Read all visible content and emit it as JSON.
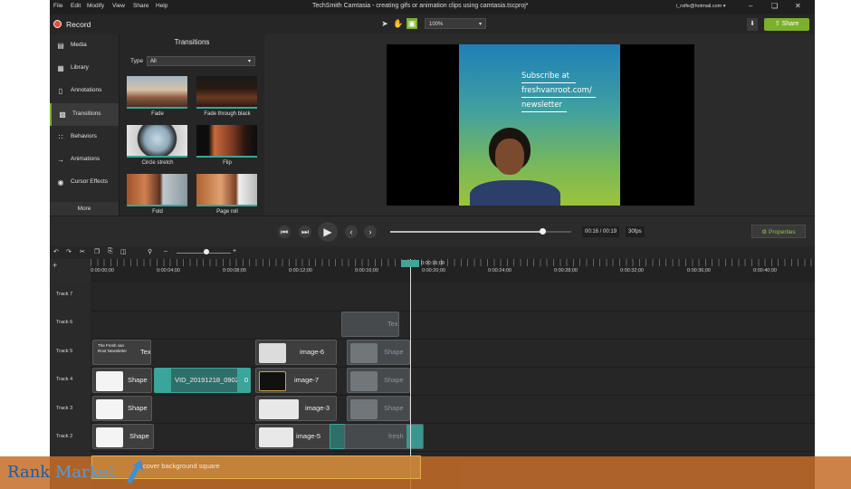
{
  "menubar": {
    "items": [
      "File",
      "Edit",
      "Modify",
      "View",
      "Share",
      "Help"
    ],
    "title": "TechSmith Camtasia - creating gifs or animation clips using camtasia.tscproj*",
    "user": "i_rolfe@hotmail.com ▾"
  },
  "toolbar": {
    "record_label": "Record",
    "zoom": "100%",
    "share_label": "Share"
  },
  "sidebar": {
    "items": [
      {
        "label": "Media"
      },
      {
        "label": "Library"
      },
      {
        "label": "Annotations"
      },
      {
        "label": "Transitions"
      },
      {
        "label": "Behaviors"
      },
      {
        "label": "Animations"
      },
      {
        "label": "Cursor Effects"
      }
    ],
    "more_label": "More"
  },
  "transitions": {
    "title": "Transitions",
    "type_label": "Type",
    "type_value": "All",
    "items": [
      {
        "label": "Fade"
      },
      {
        "label": "Fade through black"
      },
      {
        "label": "Circle stretch"
      },
      {
        "label": "Flip"
      },
      {
        "label": "Fold"
      },
      {
        "label": "Page roll"
      }
    ]
  },
  "preview": {
    "lines": [
      "Subscribe at",
      "freshvanroot.com/",
      "newsletter"
    ]
  },
  "playback": {
    "time": "00:16 / 00:19",
    "fps": "30fps",
    "progress": 0.84,
    "properties_label": "Properties"
  },
  "timeline": {
    "playhead_time": "0:00:16;08",
    "ticks": [
      "0:00:00;00",
      "0:00:04;00",
      "0:00:08;00",
      "0:00:12;00",
      "0:00:16;00",
      "0:00:20;00",
      "0:00:24;00",
      "0:00:28;00",
      "0:00:32;00",
      "0:00:36;00",
      "0:00:40;00"
    ],
    "tracks": [
      "Track 7",
      "Track 6",
      "Track 5",
      "Track 4",
      "Track 3",
      "Track 2"
    ],
    "clips": {
      "t6_ghost": "Tex",
      "t5_text": "Tex",
      "t5_newsletter": "The Fresh van Root Newsletter",
      "t5_image": "image-6",
      "t5_ghost": "Shape",
      "t4_shape": "Shape",
      "t4_vid": "VID_20191218_0902",
      "t4_vid_tail": "0",
      "t4_image": "image-7",
      "t4_ghost": "Shape",
      "t3_shape": "Shape",
      "t3_image": "image-3",
      "t3_ghost": "Shape",
      "t2_shape": "Shape",
      "t2_image": "image-5",
      "t2_ghost": "fresh"
    }
  },
  "overlay": {
    "clip_label": "cover background square",
    "brand_rank": "Rank",
    "brand_market": "Market"
  },
  "colors": {
    "accent": "#7bb02c",
    "record": "#e84b3c",
    "teal": "#3aa59b",
    "watermark": "#c46c28"
  }
}
